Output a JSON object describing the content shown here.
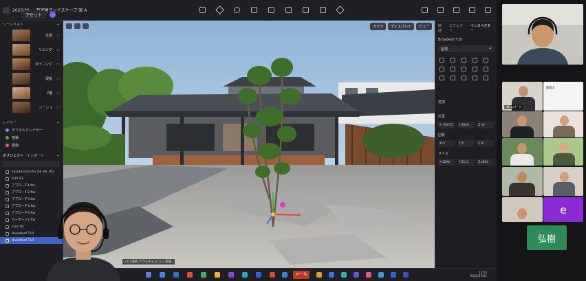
{
  "topbar": {
    "project": "2025/06 — 数寄屋ランドスケープ 案 A",
    "asset_label": "アセット",
    "center_icons": [
      "cube-icon",
      "pen-icon",
      "rotate-icon",
      "lasso-icon",
      "grid-icon",
      "box-icon",
      "brush-icon",
      "flag-icon",
      "shape-icon"
    ],
    "right_icons": [
      "share-icon",
      "image-icon",
      "camera-icon",
      "play-icon",
      "render-icon"
    ]
  },
  "scene_list": {
    "title": "シーンリスト",
    "scenes": [
      {
        "label": "玄関"
      },
      {
        "label": "リビング"
      },
      {
        "label": "ダイニング"
      },
      {
        "label": "寝室"
      },
      {
        "label": "2階"
      },
      {
        "label": "シーン 1"
      }
    ]
  },
  "layers": {
    "title": "レイヤー",
    "items": [
      {
        "label": "デフォルトレイヤー",
        "color": "#7a8cf0"
      },
      {
        "label": "植栽",
        "color": "#4caf50"
      },
      {
        "label": "建物",
        "color": "#e06666"
      }
    ]
  },
  "objects": {
    "tab_objects": "オブジェクト",
    "tab_import": "インポート",
    "items": [
      {
        "label": "kasuta moncho lok dw .fbx"
      },
      {
        "label": "SUV 03"
      },
      {
        "label": "アプローチ1.fbx"
      },
      {
        "label": "アプローチ2.fbx"
      },
      {
        "label": "アプローチ3.fbx"
      },
      {
        "label": "アプローチ4.fbx"
      },
      {
        "label": "アプローチ5.fbx"
      },
      {
        "label": "カーポート1.fbx"
      },
      {
        "label": "Cars 04"
      },
      {
        "label": "Broadleaf T10"
      },
      {
        "label": "Broadleaf T10",
        "selected": true
      }
    ]
  },
  "viewport": {
    "camera_label": "カメラ",
    "display_label": "ディスプレイ",
    "more_label": "ビュー",
    "bottom_hint": "Ctrl 選択 テクスチャ  ビュー  配置"
  },
  "inspector": {
    "tabs": [
      "環境",
      "エフェクト",
      "インスペクター"
    ],
    "active_tab": "インスペクター",
    "object_name": "Broadleaf T10",
    "material_dropdown": "屋根",
    "section_label": "変換",
    "position_label": "位置",
    "position": {
      "x": "X -35673",
      "y": "Y 8528",
      "z": "Z 50"
    },
    "rotation_label": "回転",
    "rotation": {
      "x": "X 0°",
      "y": "Y 0°",
      "z": "Z 0°"
    },
    "size_label": "サイズ",
    "size": {
      "x": "X 2000",
      "y": "Y 2111",
      "z": "Z 4600"
    }
  },
  "taskbar": {
    "mail_label": "メール",
    "time": "13:14",
    "date": "2025/07/01"
  },
  "video": {
    "participants": [
      {
        "name": ""
      },
      {
        "name": "(株)スパーク"
      },
      {
        "name": "関東太"
      },
      {
        "name": ""
      },
      {
        "name": ""
      },
      {
        "name": ""
      },
      {
        "name": ""
      },
      {
        "name": ""
      },
      {
        "name": ""
      },
      {
        "name": "e"
      },
      {
        "name": "弘樹"
      }
    ]
  },
  "colors": {
    "accent": "#3b63c8",
    "panel": "#1f1f23",
    "mail": "#b83a2a",
    "tile_e": "#8a2bd6",
    "tile_hiroki": "#2e8b57"
  }
}
